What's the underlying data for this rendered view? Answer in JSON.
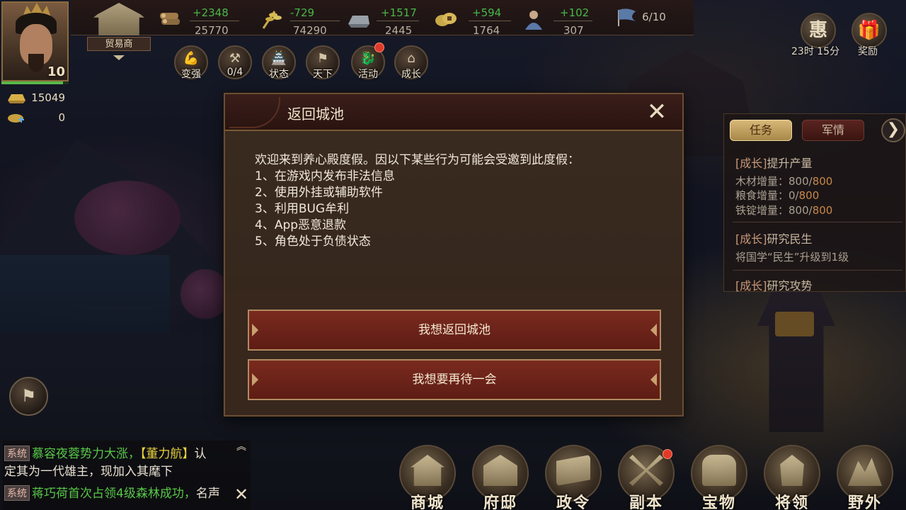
{
  "player": {
    "level": "10",
    "gold": "15049",
    "gems": "0"
  },
  "trader": {
    "label": "贸易商"
  },
  "resources": [
    {
      "name": "wood",
      "icon": "wood-log-icon",
      "delta": "+2348",
      "total": "25770"
    },
    {
      "name": "food",
      "icon": "wheat-icon",
      "delta": "-729",
      "total": "74290"
    },
    {
      "name": "iron",
      "icon": "iron-ingot-icon",
      "delta": "+1517",
      "total": "2445"
    },
    {
      "name": "copper",
      "icon": "copper-coin-icon",
      "delta": "+594",
      "total": "1764"
    },
    {
      "name": "population",
      "icon": "soldier-icon",
      "delta": "+102",
      "total": "307"
    }
  ],
  "troops": {
    "icon": "flag-icon",
    "value": "6/10"
  },
  "right_buttons": {
    "promo": {
      "glyph": "惠",
      "timer": "23时 15分"
    },
    "reward": {
      "glyph": "🎁",
      "label": "奖励"
    }
  },
  "quick_buttons": [
    {
      "label": "变强",
      "glyph": "💪",
      "badge": false
    },
    {
      "label": "0/4",
      "glyph": "⚒",
      "badge": false
    },
    {
      "label": "状态",
      "glyph": "🏯",
      "badge": false
    },
    {
      "label": "天下",
      "glyph": "⚑",
      "badge": false
    },
    {
      "label": "活动",
      "glyph": "🐉",
      "badge": true
    },
    {
      "label": "成长",
      "glyph": "⌂",
      "badge": false
    }
  ],
  "task_panel": {
    "tabs": [
      "任务",
      "军情"
    ],
    "next_glyph": "❯",
    "tasks": [
      {
        "tag": "[成长]",
        "title": "提升产量"
      },
      {
        "label": "木材增量：",
        "progress": "800/",
        "goal": "800"
      },
      {
        "label": "粮食增量：",
        "progress": "0/",
        "goal": "800"
      },
      {
        "label": "铁锭增量：",
        "progress": "800/",
        "goal": "800"
      },
      {
        "tag": "[成长]",
        "title": "研究民生"
      },
      {
        "text": "将国学“民生”升级到1级"
      },
      {
        "tag": "[成长]",
        "title": "研究攻势"
      }
    ]
  },
  "modal": {
    "title": "返回城池",
    "close_glyph": "✕",
    "message_lines": [
      "欢迎来到养心殿度假。因以下某些行为可能会受邀到此度假：",
      "1、在游戏内发布非法信息",
      "2、使用外挂或辅助软件",
      "3、利用BUG牟利",
      "4、App恶意退款",
      "5、角色处于负债状态"
    ],
    "confirm_label": "我想返回城池",
    "stay_label": "我想要再待一会"
  },
  "chat": {
    "system_tag": "系统",
    "line1_green": "慕容夜蓉势力大涨，",
    "line1_yellow": "【董力航】",
    "line1_tail": "认",
    "line2": "定其为一代雄主，现加入其麾下",
    "line3_green": "蒋巧荷首次占领4级森林成功，",
    "line3_tail": "名声",
    "up_glyph": "︽",
    "close_glyph": "✕",
    "flag_glyph": "⚑"
  },
  "bottom_menu": [
    "商城",
    "府邸",
    "政令",
    "副本",
    "宝物",
    "将领",
    "野外"
  ],
  "bottom_menu_badge_index": 3
}
